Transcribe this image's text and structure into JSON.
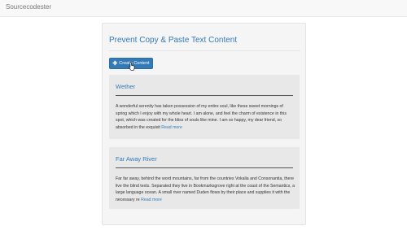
{
  "navbar": {
    "brand": "Sourcecodester"
  },
  "main": {
    "title": "Prevent Copy & Paste Text Content",
    "create_button": {
      "icon": "plus-icon",
      "label": "Create Content"
    },
    "cards": [
      {
        "title": "Wether",
        "text": "A wonderful serenity has taken possession of my entire soul, like these sweet mornings of spring which I enjoy with my whole heart. I am alone, and feel the charm of existence in this spot, which was created for the bliss of souls like mine. I am so happy, my dear friend, so absorbed in the exquisit",
        "link": "Read more"
      },
      {
        "title": "Far Away River",
        "text": "Far far away, behind the word mountains, far from the countries Vokalia and Consonantia, there live the blind texts. Separated they live in Bookmarksgrove right at the coast of the Semantics, a large language ocean. A small river named Duden flows by their place and supplies it with the necessary re",
        "link": "Read more"
      }
    ]
  },
  "colors": {
    "accent": "#337ab7",
    "panel": "#f5f5f5",
    "card": "#e8e8e8",
    "navbar": "#f8f8f8"
  }
}
